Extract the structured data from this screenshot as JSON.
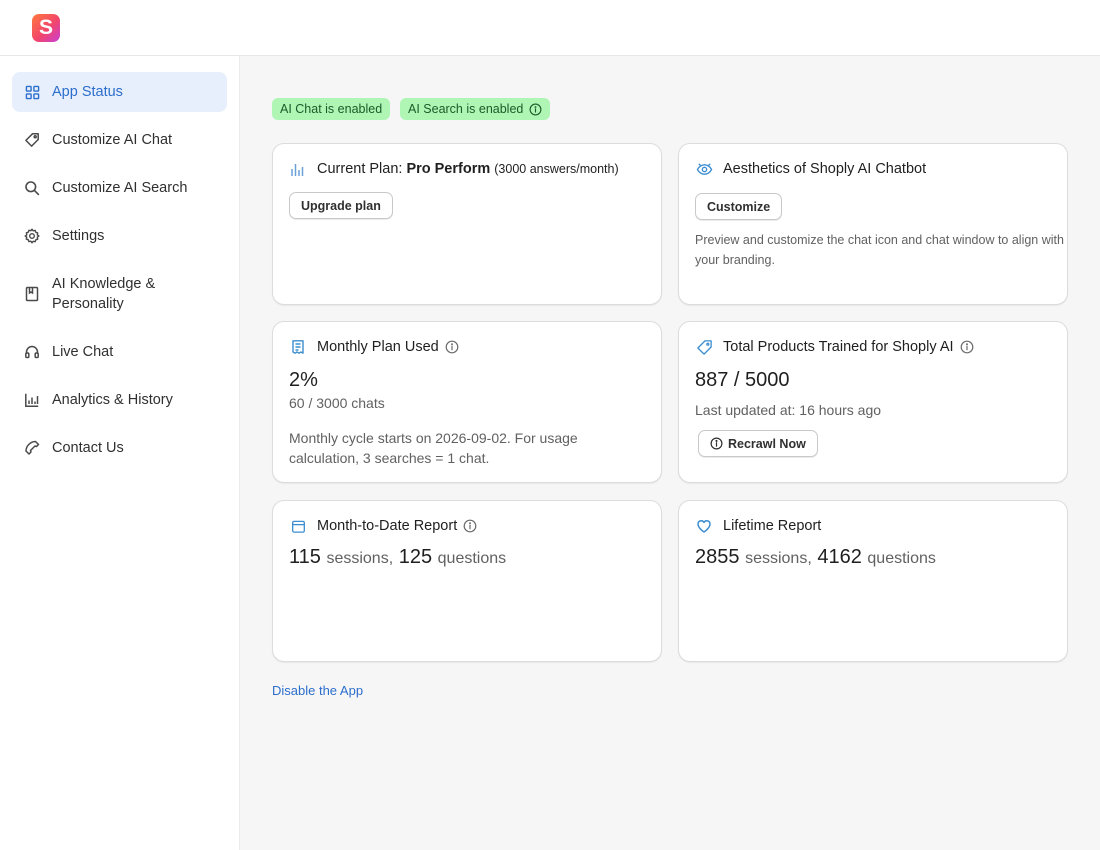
{
  "app": {
    "logo_letter": "S",
    "brand_color": "#f2456b",
    "accent_color": "#2c6ecb"
  },
  "sidebar": {
    "items": [
      {
        "label": "App Status",
        "icon": "grid-icon",
        "active": true
      },
      {
        "label": "Customize AI Chat",
        "icon": "tag-icon"
      },
      {
        "label": "Customize AI Search",
        "icon": "search-icon"
      },
      {
        "label": "Settings",
        "icon": "gear-icon"
      },
      {
        "label": "AI Knowledge & Personality",
        "icon": "book-icon"
      },
      {
        "label": "Live Chat",
        "icon": "headset-icon"
      },
      {
        "label": "Analytics & History",
        "icon": "bar-chart-icon"
      },
      {
        "label": "Contact Us",
        "icon": "phone-icon"
      }
    ]
  },
  "badges": {
    "chat": "AI Chat is enabled",
    "search": "AI Search is enabled",
    "color": "#aff5b4"
  },
  "plan_card": {
    "prefix": "Current Plan:",
    "plan_name": "Pro Perform",
    "quota": "(3000 answers/month)",
    "button": "Upgrade plan"
  },
  "aesthetics_card": {
    "title": "Aesthetics of Shoply AI Chatbot",
    "button": "Customize",
    "description_line1": "Preview and customize the chat icon and chat window to align with",
    "description_line2": "your branding."
  },
  "usage_card": {
    "title": "Monthly Plan Used",
    "percent": "2%",
    "detail": "60 / 3000 chats",
    "note_line1": "Monthly cycle starts on 2026-09-02. For usage",
    "note_line2": "calculation, 3 searches = 1 chat."
  },
  "products_card": {
    "title": "Total Products Trained for Shoply AI",
    "count": "887 / 5000",
    "updated": "Last updated at: 16 hours ago",
    "button": "Recrawl Now"
  },
  "mtd_card": {
    "title": "Month-to-Date Report",
    "sessions": "115",
    "sessions_label": "sessions,",
    "questions": "125",
    "questions_label": "questions"
  },
  "lifetime_card": {
    "title": "Lifetime Report",
    "sessions": "2855",
    "sessions_label": "sessions,",
    "questions": "4162",
    "questions_label": "questions"
  },
  "footer_link": "Disable the App"
}
